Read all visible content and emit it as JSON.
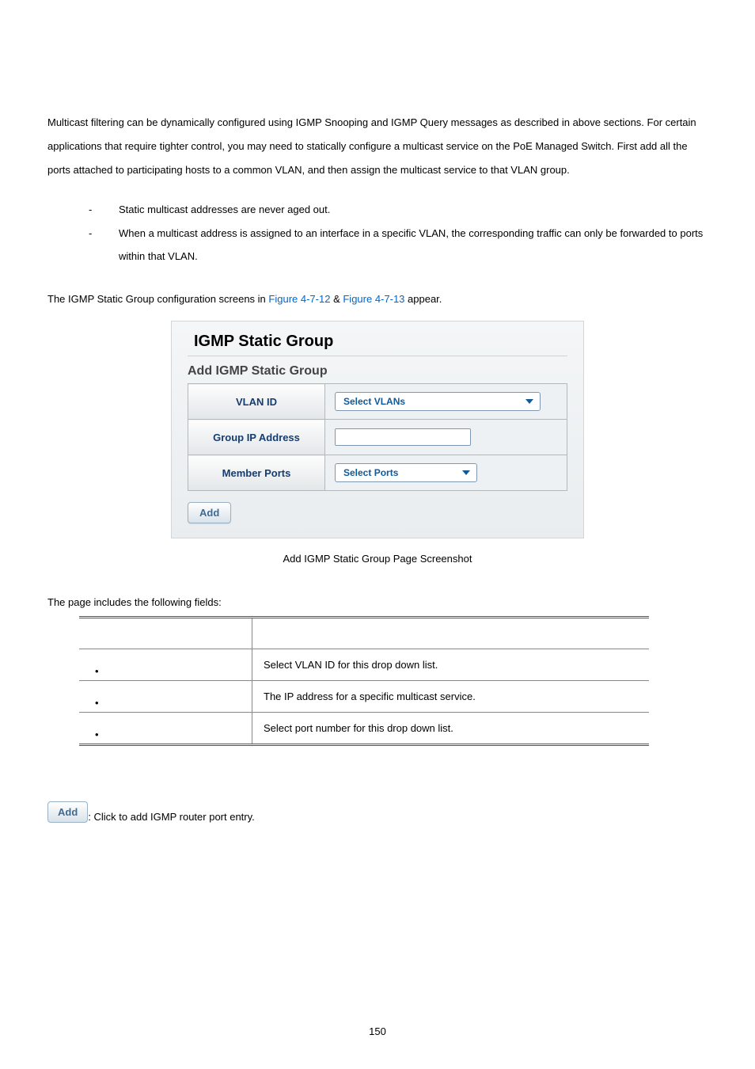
{
  "intro": "Multicast filtering can be dynamically configured using IGMP Snooping and IGMP Query messages as described in above sections. For certain applications that require tighter control, you may need to statically configure a multicast service on the PoE Managed Switch. First add all the ports attached to participating hosts to a common VLAN, and then assign the multicast service to that VLAN group.",
  "bullets": [
    "Static multicast addresses are never aged out.",
    "When a multicast address is assigned to an interface in a specific VLAN, the corresponding traffic can only be forwarded to ports within that VLAN."
  ],
  "refline_prefix": "The IGMP Static Group configuration screens in ",
  "refline_link1": "Figure 4-7-12",
  "refline_mid": " & ",
  "refline_link2": "Figure 4-7-13",
  "refline_suffix": " appear.",
  "panel": {
    "title": "IGMP Static Group",
    "subtitle": "Add IGMP Static Group",
    "rows": {
      "vlan_label": "VLAN ID",
      "vlan_placeholder": "Select VLANs",
      "ip_label": "Group IP Address",
      "ports_label": "Member Ports",
      "ports_placeholder": "Select Ports"
    },
    "add_label": "Add"
  },
  "caption": "Add IGMP Static Group Page Screenshot",
  "fields_intro": "The page includes the following fields:",
  "desc_rows": [
    {
      "desc": "Select VLAN ID for this drop down list."
    },
    {
      "desc": "The IP address for a specific multicast service."
    },
    {
      "desc": "Select port number for this drop down list."
    }
  ],
  "add_button_label": "Add",
  "add_button_desc": ": Click to add IGMP router port entry.",
  "page_number": "150"
}
